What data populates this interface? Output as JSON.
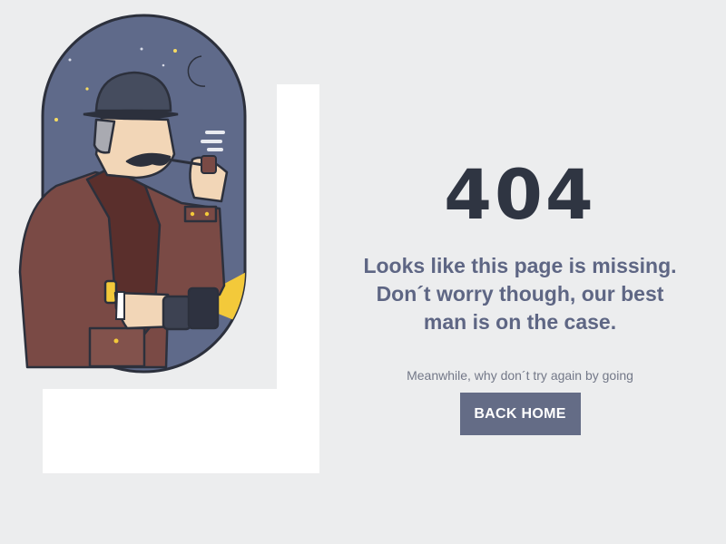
{
  "error": {
    "code": "404",
    "message_lines": [
      "Looks like this page is missing.",
      "Don´t worry though, our best",
      "man is on the case."
    ],
    "subtext": "Meanwhile, why don´t try again by going",
    "button_label": "BACK HOME"
  },
  "illustration": {
    "name": "detective-illustration",
    "icons": [
      "moon-icon",
      "star-icon",
      "bowler-hat-icon",
      "pipe-icon",
      "flashlight-icon"
    ]
  },
  "colors": {
    "background": "#ecedee",
    "heading": "#2f3542",
    "message": "#5e6684",
    "button_bg": "#646c86",
    "button_text": "#ffffff",
    "night_sky": "#5f6a8a",
    "coat": "#7a4a45"
  }
}
